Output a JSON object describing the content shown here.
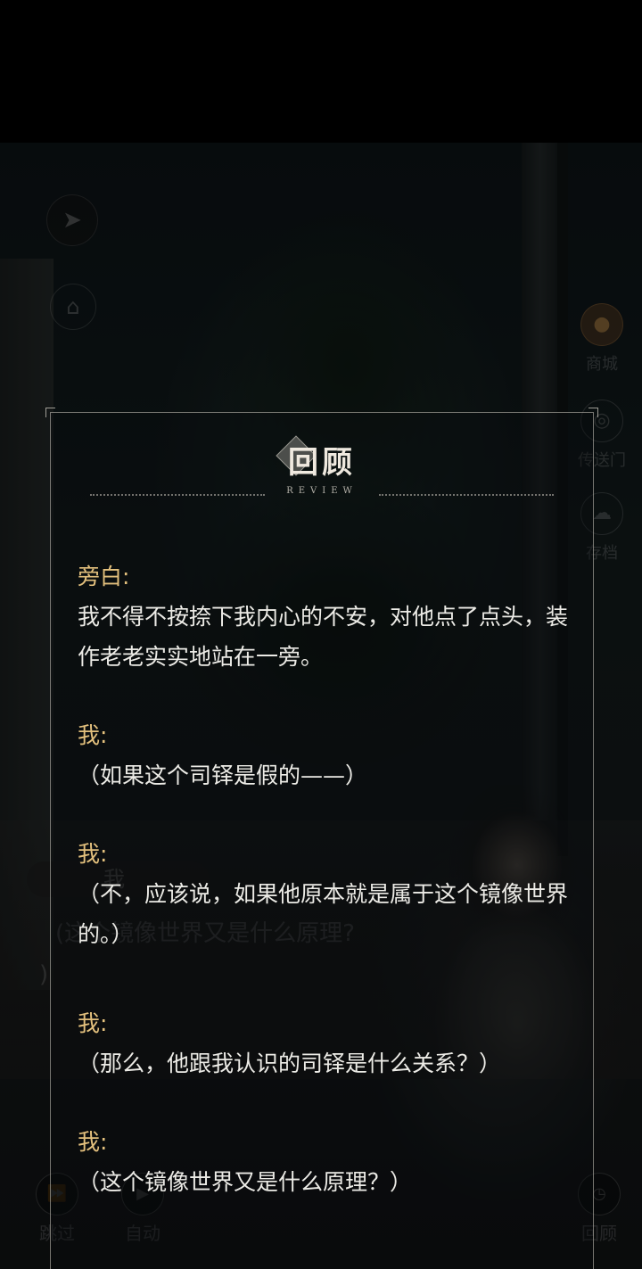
{
  "background_ui": {
    "speaker_tag": "我",
    "dialogue_line1": "(这个镜像世界又是什么原理?",
    "dialogue_line2": ")",
    "side_buttons": {
      "shop_label": "商城",
      "portal_label": "传送门",
      "save_label": "存档"
    },
    "controls": {
      "skip_label": "跳过",
      "auto_label": "自动",
      "review_label": "回顾"
    }
  },
  "review": {
    "title": "回顾",
    "subtitle": "REVIEW",
    "entries": [
      {
        "speaker": "旁白:",
        "text": "我不得不按捺下我内心的不安，对他点了点头，装作老老实实地站在一旁。"
      },
      {
        "speaker": "我:",
        "text": "（如果这个司铎是假的——）"
      },
      {
        "speaker": "我:",
        "text": "（不，应该说，如果他原本就是属于这个镜像世界的。）"
      },
      {
        "speaker": "我:",
        "text": "（那么，他跟我认识的司铎是什么关系？）"
      },
      {
        "speaker": "我:",
        "text": "（这个镜像世界又是什么原理？）"
      }
    ]
  },
  "colors": {
    "speaker": "#e3c07d",
    "text": "#ecebe6",
    "panel_border": "#d2cdc3"
  }
}
